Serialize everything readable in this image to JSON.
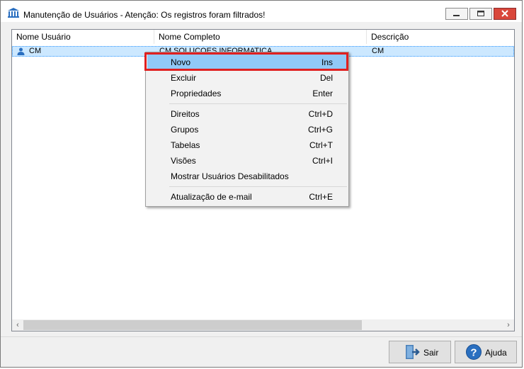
{
  "window": {
    "title": "Manutenção de Usuários - Atenção: Os registros foram filtrados!"
  },
  "grid": {
    "columns": [
      "Nome Usuário",
      "Nome Completo",
      "Descrição"
    ],
    "rows": [
      {
        "user": "CM",
        "full_name": "CM SOLUCOES INFORMATICA",
        "description": "CM"
      }
    ]
  },
  "context_menu": {
    "items": [
      {
        "label": "Novo",
        "shortcut": "Ins"
      },
      {
        "label": "Excluir",
        "shortcut": "Del"
      },
      {
        "label": "Propriedades",
        "shortcut": "Enter"
      },
      {
        "label": "Direitos",
        "shortcut": "Ctrl+D"
      },
      {
        "label": "Grupos",
        "shortcut": "Ctrl+G"
      },
      {
        "label": "Tabelas",
        "shortcut": "Ctrl+T"
      },
      {
        "label": "Visões",
        "shortcut": "Ctrl+I"
      },
      {
        "label": "Mostrar Usuários Desabilitados",
        "shortcut": ""
      },
      {
        "label": "Atualização de e-mail",
        "shortcut": "Ctrl+E"
      }
    ],
    "highlighted": "Novo"
  },
  "buttons": {
    "exit": "Sair",
    "help": "Ajuda"
  },
  "colors": {
    "highlight": "#91c9f7",
    "annotation_box": "#e02020",
    "selected_row": "#cce8ff"
  }
}
